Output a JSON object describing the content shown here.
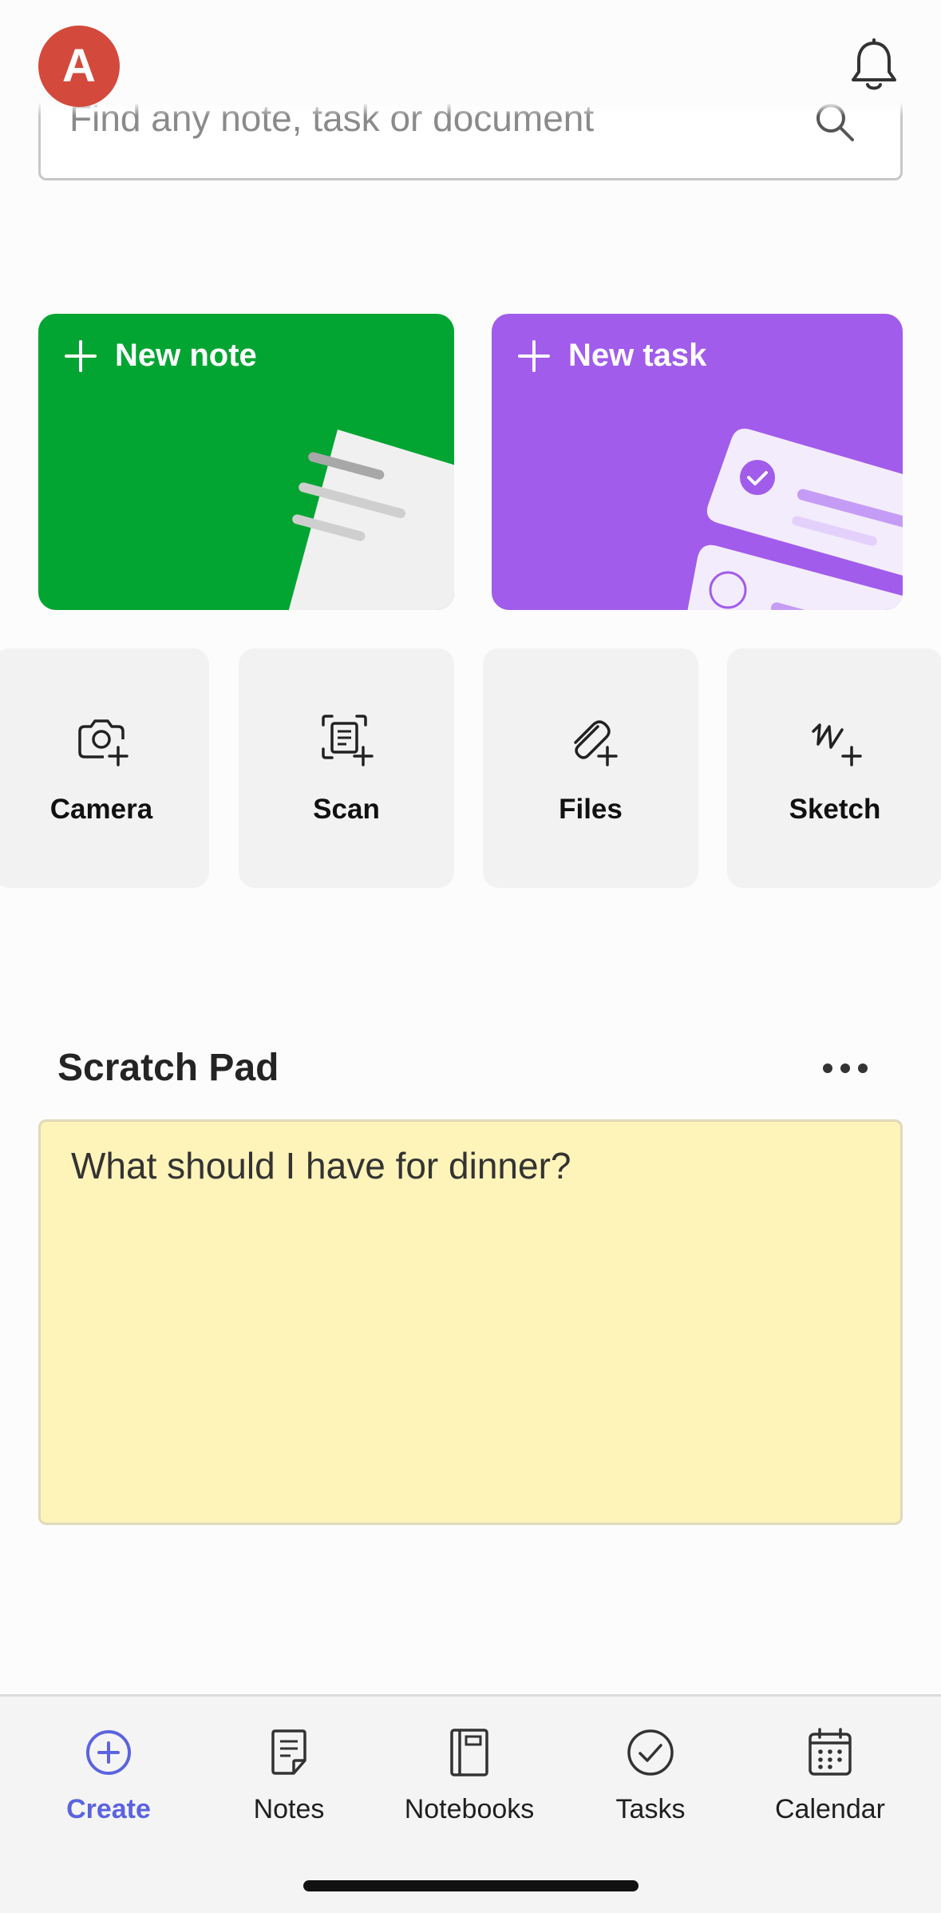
{
  "header": {
    "avatar_initial": "A"
  },
  "search": {
    "placeholder": "Find any note, task or document"
  },
  "actions": {
    "new_note": "New note",
    "new_task": "New task"
  },
  "tiles": [
    {
      "label": "Camera",
      "icon": "camera-plus-icon"
    },
    {
      "label": "Scan",
      "icon": "scan-document-icon"
    },
    {
      "label": "Files",
      "icon": "paperclip-plus-icon"
    },
    {
      "label": "Sketch",
      "icon": "sketch-plus-icon"
    }
  ],
  "scratch_pad": {
    "title": "Scratch Pad",
    "text": "What should I have for dinner?"
  },
  "tabs": [
    {
      "label": "Create",
      "icon": "plus-circle-icon",
      "active": true
    },
    {
      "label": "Notes",
      "icon": "note-icon",
      "active": false
    },
    {
      "label": "Notebooks",
      "icon": "notebook-icon",
      "active": false
    },
    {
      "label": "Tasks",
      "icon": "check-circle-icon",
      "active": false
    },
    {
      "label": "Calendar",
      "icon": "calendar-icon",
      "active": false
    }
  ],
  "colors": {
    "note_green": "#02a532",
    "task_purple": "#a15ceb",
    "accent_blue": "#5b63e0",
    "avatar_red": "#d34a3c",
    "scratch_yellow": "#fef3b9"
  }
}
